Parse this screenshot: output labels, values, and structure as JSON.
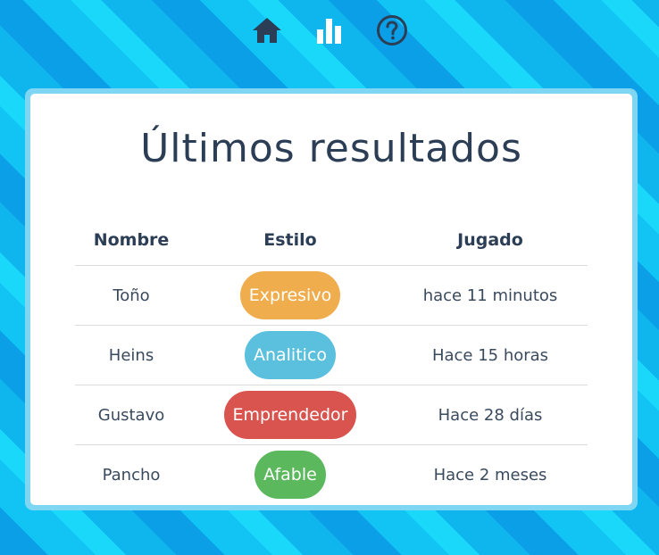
{
  "nav": {
    "icons": [
      "home-icon",
      "bar-chart-icon",
      "question-circle-icon"
    ],
    "icon_color": "#2c3e55",
    "chart_icon_color": "#ffffff"
  },
  "card": {
    "title": "Últimos resultados"
  },
  "table": {
    "headers": [
      "Nombre",
      "Estilo",
      "Jugado"
    ],
    "rows": [
      {
        "name": "Toño",
        "style": "Expresivo",
        "style_color": "#f0ad4e",
        "played": "hace 11 minutos"
      },
      {
        "name": "Heins",
        "style": "Analitico",
        "style_color": "#5bc0de",
        "played": "Hace 15 horas"
      },
      {
        "name": "Gustavo",
        "style": "Emprendedor",
        "style_color": "#d9534f",
        "played": "Hace 28 días"
      },
      {
        "name": "Pancho",
        "style": "Afable",
        "style_color": "#5cb85c",
        "played": "Hace 2 meses"
      }
    ]
  }
}
